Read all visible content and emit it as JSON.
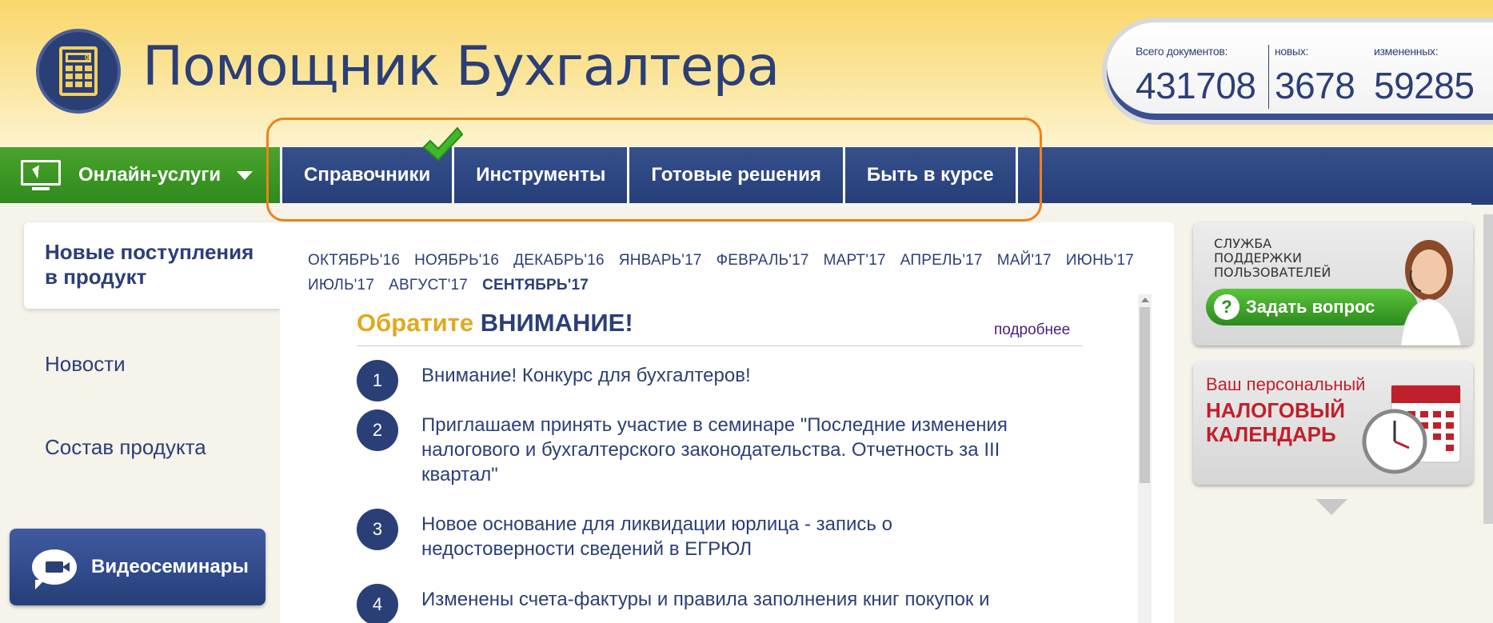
{
  "header": {
    "title": "Помощник Бухгалтера",
    "calc_display": "0",
    "counters": [
      {
        "label": "Всего документов:",
        "value": "431708"
      },
      {
        "label": "новых:",
        "value": "3678"
      },
      {
        "label": "измененных:",
        "value": "59285"
      }
    ]
  },
  "nav": {
    "online_label": "Онлайн-услуги",
    "tabs": [
      "Справочники",
      "Инструменты",
      "Готовые решения",
      "Быть в курсе"
    ]
  },
  "sidebar": {
    "new_line1": "Новые поступления",
    "new_line2": "в продукт",
    "news": "Новости",
    "composition": "Состав продукта",
    "video": "Видеосеминары"
  },
  "months": [
    "ОКТЯБРЬ'16",
    "НОЯБРЬ'16",
    "ДЕКАБРЬ'16",
    "ЯНВАРЬ'17",
    "ФЕВРАЛЬ'17",
    "МАРТ'17",
    "АПРЕЛЬ'17",
    "МАЙ'17",
    "ИЮНЬ'17",
    "ИЮЛЬ'17",
    "АВГУСТ'17",
    "СЕНТЯБРЬ'17"
  ],
  "attention": {
    "word1": "Обратите",
    "word2": "ВНИМАНИЕ!",
    "more": "подробнее",
    "items": [
      {
        "num": "1",
        "text": "Внимание! Конкурс для бухгалтеров!"
      },
      {
        "num": "2",
        "text": "Приглашаем принять участие в семинаре \"Последние изменения налогового и бухгалтерского законодательства. Отчетность за III квартал\""
      },
      {
        "num": "3",
        "text": "Новое основание для ликвидации юрлица - запись о недостоверности сведений в ЕГРЮЛ"
      },
      {
        "num": "4",
        "text": "Изменены счета-фактуры и правила заполнения книг покупок и"
      }
    ]
  },
  "banners": {
    "support_l1": "СЛУЖБА",
    "support_l2": "ПОДДЕРЖКИ",
    "support_l3": "ПОЛЬЗОВАТЕЛЕЙ",
    "ask": "Задать вопрос",
    "cal_l1": "Ваш персональный",
    "cal_l2": "НАЛОГОВЫЙ",
    "cal_l3": "КАЛЕНДАРЬ"
  },
  "colors": {
    "navy": "#2b3f77",
    "green": "#3f9a26",
    "highlight": "#f0801c",
    "gold": "#e0a91e"
  }
}
